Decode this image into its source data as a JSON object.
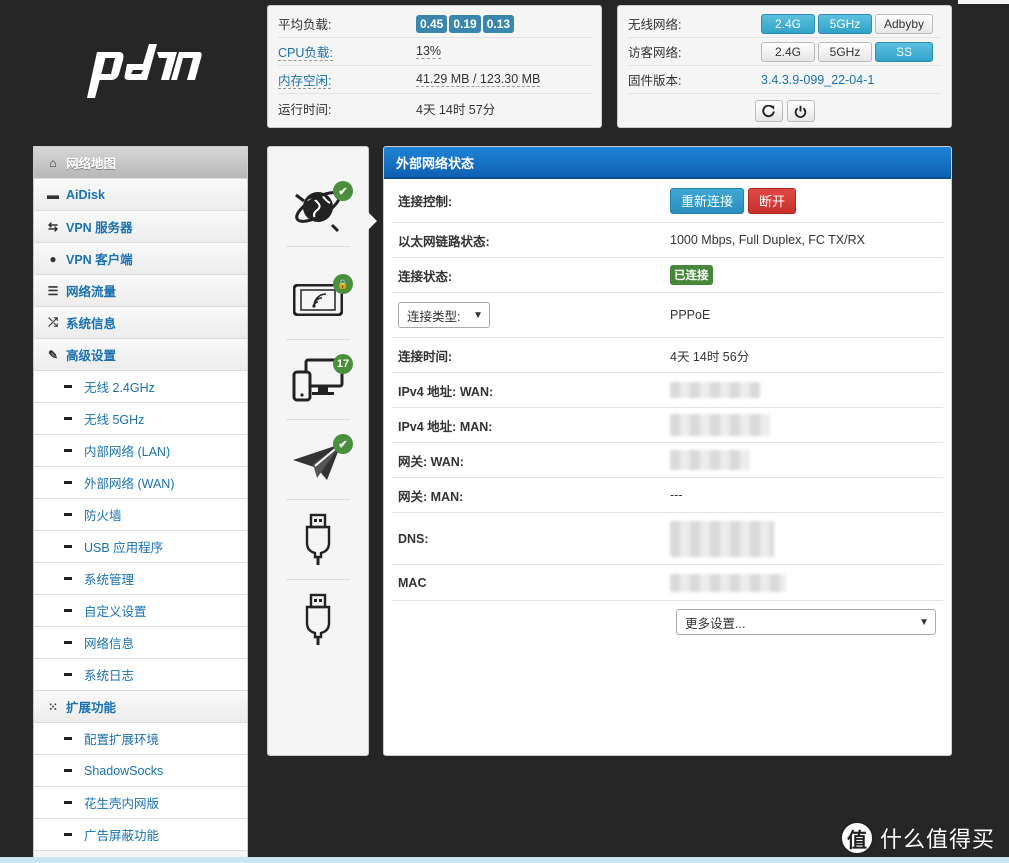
{
  "logo_text": "pdcn",
  "status": {
    "load_label": "平均负载:",
    "load_values": [
      "0.45",
      "0.19",
      "0.13"
    ],
    "cpu_label": "CPU负载:",
    "cpu_value": "13%",
    "mem_label": "内存空闲:",
    "mem_value": "41.29 MB / 123.30 MB",
    "uptime_label": "运行时间:",
    "uptime_value": "4天 14时 57分"
  },
  "wireless": {
    "wifi_label": "无线网络:",
    "wifi_buttons": [
      {
        "label": "2.4G",
        "active": true
      },
      {
        "label": "5GHz",
        "active": true
      },
      {
        "label": "Adbyby",
        "active": false
      }
    ],
    "guest_label": "访客网络:",
    "guest_buttons": [
      {
        "label": "2.4G",
        "active": false
      },
      {
        "label": "5GHz",
        "active": false
      },
      {
        "label": "SS",
        "active": true
      }
    ],
    "firmware_label": "固件版本:",
    "firmware_value": "3.4.3.9-099_22-04-1"
  },
  "sidebar": {
    "items": [
      {
        "label": "网络地图",
        "icon": "home-icon"
      },
      {
        "label": "AiDisk",
        "icon": "hdd-icon"
      },
      {
        "label": "VPN 服务器",
        "icon": "retweet-icon"
      },
      {
        "label": "VPN 客户端",
        "icon": "globe-icon"
      },
      {
        "label": "网络流量",
        "icon": "tasks-icon"
      },
      {
        "label": "系统信息",
        "icon": "random-icon"
      },
      {
        "label": "高级设置",
        "icon": "wrench-icon"
      }
    ],
    "advanced": [
      "无线 2.4GHz",
      "无线 5GHz",
      "内部网络 (LAN)",
      "外部网络 (WAN)",
      "防火墙",
      "USB 应用程序",
      "系统管理",
      "自定义设置",
      "网络信息",
      "系统日志"
    ],
    "ext_label": "扩展功能",
    "ext_icon": "grid-icon",
    "extensions": [
      "配置扩展环境",
      "ShadowSocks",
      "花生壳内网版",
      "广告屏蔽功能"
    ]
  },
  "devices": [
    {
      "icon": "internet-globe-icon",
      "badge": "✔"
    },
    {
      "icon": "wireless-tablet-icon",
      "badge": "🔒"
    },
    {
      "icon": "clients-icon",
      "badge": "17"
    },
    {
      "icon": "paper-plane-icon",
      "badge": "✔"
    },
    {
      "icon": "usb-icon",
      "badge": ""
    },
    {
      "icon": "usb-icon",
      "badge": ""
    }
  ],
  "wan": {
    "title": "外部网络状态",
    "control_label": "连接控制:",
    "reconnect_label": "重新连接",
    "disconnect_label": "断开",
    "link_label": "以太网链路状态:",
    "link_value": "1000 Mbps, Full Duplex, FC TX/RX",
    "conn_label": "连接状态:",
    "conn_value": "已连接",
    "type_select": "连接类型:",
    "type_value": "PPPoE",
    "time_label": "连接时间:",
    "time_value": "4天 14时 56分",
    "ipv4_wan_label": "IPv4 地址: WAN:",
    "ipv4_man_label": "IPv4 地址: MAN:",
    "gw_wan_label": "网关: WAN:",
    "gw_man_label": "网关: MAN:",
    "gw_man_value": "---",
    "dns_label": "DNS:",
    "mac_label": "MAC",
    "more_select": "更多设置..."
  },
  "watermark": {
    "symbol": "值",
    "text": "什么值得买"
  }
}
